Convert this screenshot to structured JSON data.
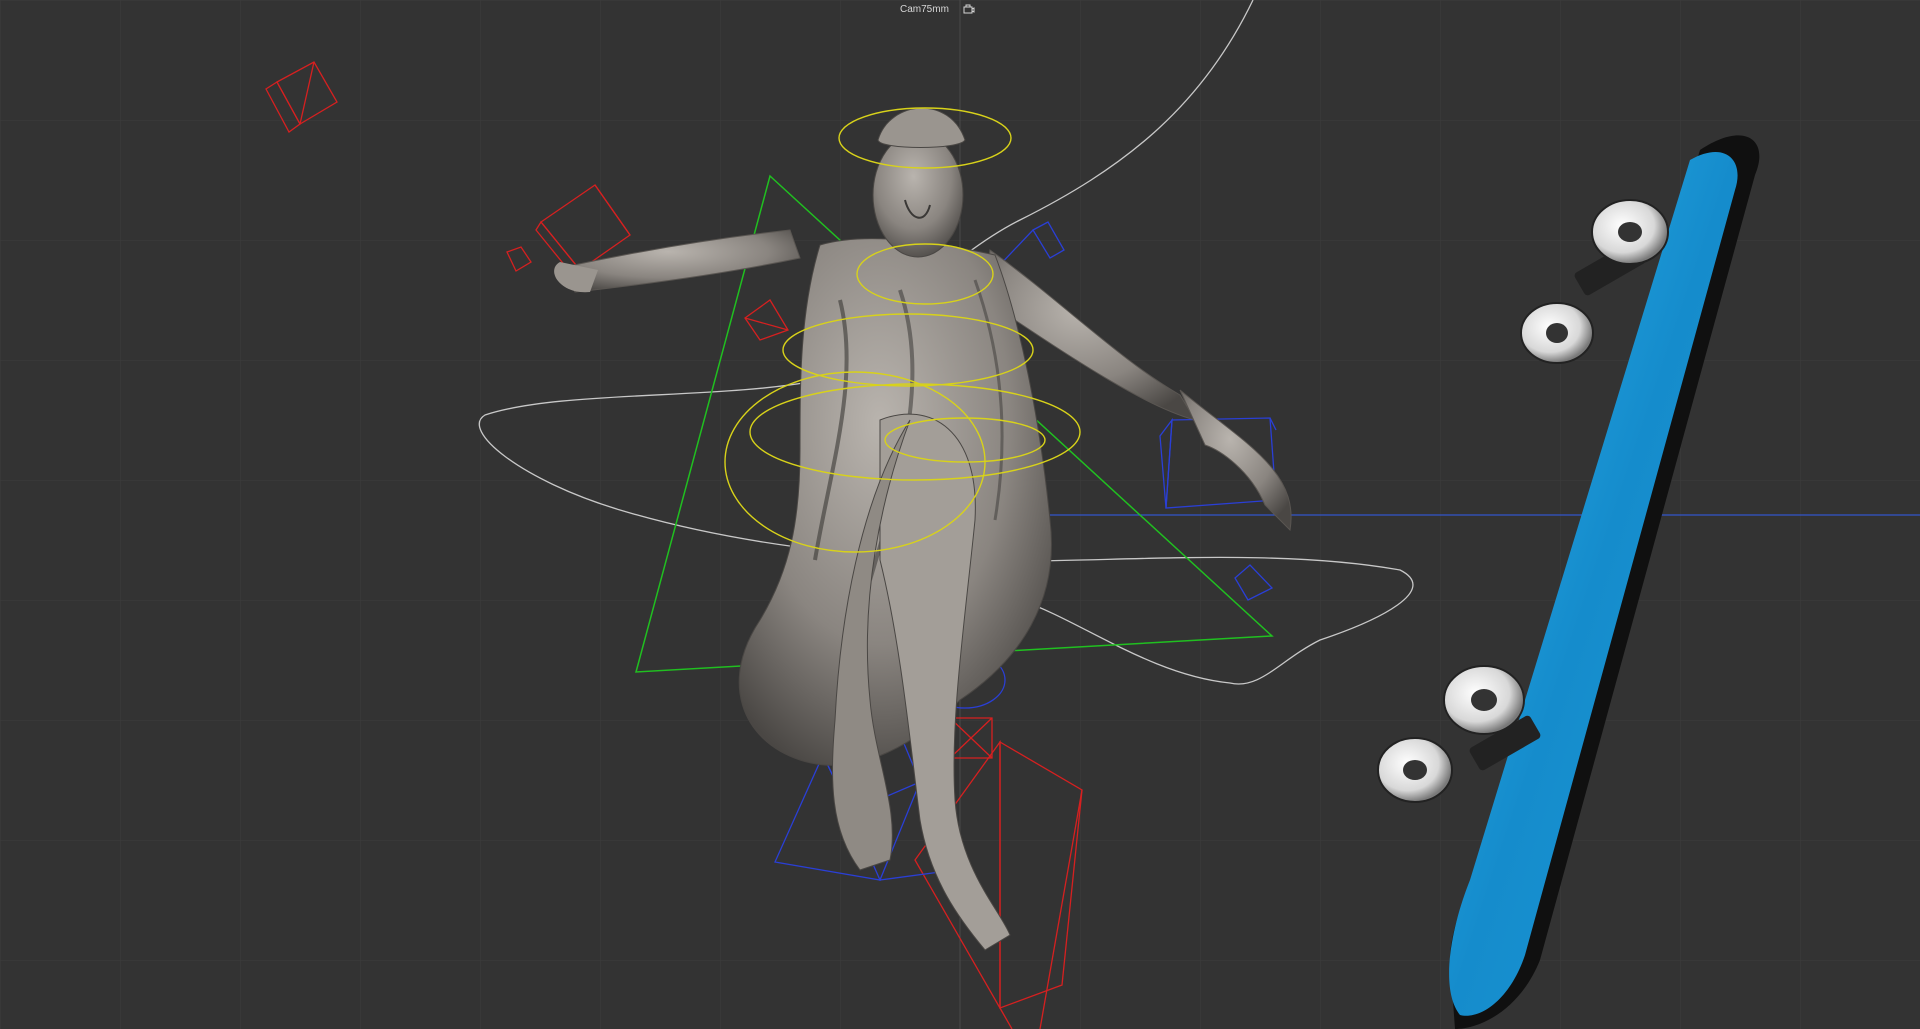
{
  "viewport": {
    "camera_name": "Cam75mm",
    "camera_lock_icon": "camera-lock-icon",
    "background": "#333333",
    "grid_color": "#3c3c3c",
    "axis_color": "#3355cc",
    "colors": {
      "locator": "#d62020",
      "control": "#2a3fd6",
      "joint_ring": "#d8d21a",
      "ik_triangle": "#20c020",
      "motion_path": "#c8c8c8",
      "statue": "#8a8580",
      "skateboard_deck": "#1e9ad6",
      "wheel": "#e8e8e8"
    },
    "objects": [
      "statue-mesh",
      "skateboard-mesh",
      "motion-path",
      "rig-controls"
    ]
  }
}
